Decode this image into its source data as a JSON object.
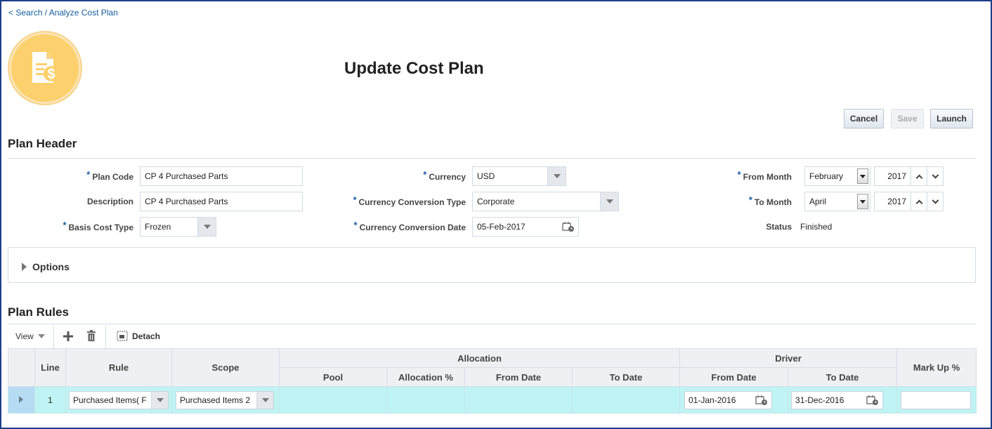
{
  "breadcrumb": {
    "text": "< Search / Analyze Cost Plan"
  },
  "page": {
    "title": "Update Cost Plan"
  },
  "actions": {
    "cancel": "Cancel",
    "save": "Save",
    "launch": "Launch"
  },
  "plan_header": {
    "title": "Plan Header",
    "plan_code": {
      "label": "Plan Code",
      "value": "CP 4 Purchased Parts"
    },
    "description": {
      "label": "Description",
      "value": "CP 4 Purchased Parts"
    },
    "basis_cost_type": {
      "label": "Basis Cost Type",
      "value": "Frozen"
    },
    "currency": {
      "label": "Currency",
      "value": "USD"
    },
    "currency_conversion_type": {
      "label": "Currency Conversion Type",
      "value": "Corporate"
    },
    "currency_conversion_date": {
      "label": "Currency Conversion Date",
      "value": "05-Feb-2017"
    },
    "from_month": {
      "label": "From Month",
      "month": "February",
      "year": "2017"
    },
    "to_month": {
      "label": "To Month",
      "month": "April",
      "year": "2017"
    },
    "status": {
      "label": "Status",
      "value": "Finished"
    },
    "required_mark": "*"
  },
  "options": {
    "label": "Options"
  },
  "plan_rules": {
    "title": "Plan Rules",
    "toolbar": {
      "view": "View",
      "detach": "Detach"
    },
    "columns": {
      "line": "Line",
      "rule": "Rule",
      "scope": "Scope",
      "allocation": "Allocation",
      "pool": "Pool",
      "allocation_pct": "Allocation %",
      "from_date": "From Date",
      "to_date": "To Date",
      "driver": "Driver",
      "driver_from_date": "From Date",
      "driver_to_date": "To Date",
      "mark_up": "Mark Up %"
    },
    "rows": [
      {
        "line": "1",
        "rule": "Purchased Items( F",
        "scope": "Purchased Items 2",
        "pool": "",
        "allocation_pct": "",
        "from_date": "",
        "to_date": "",
        "driver_from_date": "01-Jan-2016",
        "driver_to_date": "31-Dec-2016",
        "mark_up": ""
      }
    ]
  },
  "colors": {
    "accent": "#1c5ea8",
    "row_highlight": "#bff3f4",
    "logo": "#fcd06d"
  }
}
